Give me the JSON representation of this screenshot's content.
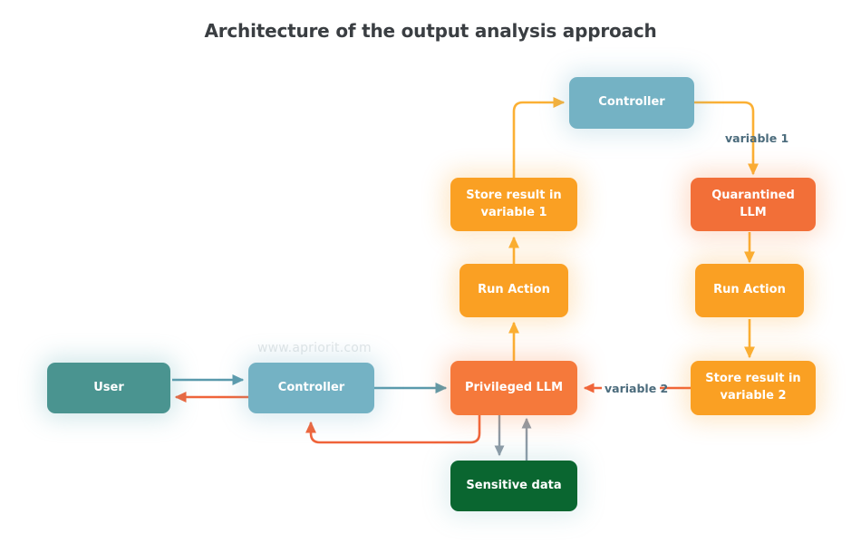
{
  "diagram": {
    "title": "Architecture of the output analysis approach",
    "watermark": "www.apriorit.com",
    "colors": {
      "user_teal": "#4a9490",
      "controller_blue": "#74b2c4",
      "privileged_orange": "#f5793b",
      "quarantined_orange": "#f26f38",
      "action_amber": "#faa023",
      "sensitive_green": "#0a6630",
      "arrow_amber": "#fbb034",
      "arrow_orange": "#f0643a",
      "arrow_teal": "#5a9aac",
      "arrow_gray": "#8d9aa6",
      "label_text": "#4b6b7c",
      "title_text": "#3a3e42",
      "watermark_text": "#e2e6e8"
    },
    "nodes": {
      "user": "User",
      "controller_left": "Controller",
      "controller_top": "Controller",
      "privileged_llm": "Privileged LLM",
      "quarantined_llm": "Quarantined LLM",
      "run_action_mid": "Run Action",
      "run_action_right": "Run Action",
      "store_result_1": "Store result in\nvariable 1",
      "store_result_2": "Store result in\nvariable 2",
      "sensitive_data": "Sensitive data"
    },
    "edge_labels": {
      "variable_1": "variable 1",
      "variable_2": "variable 2"
    }
  }
}
